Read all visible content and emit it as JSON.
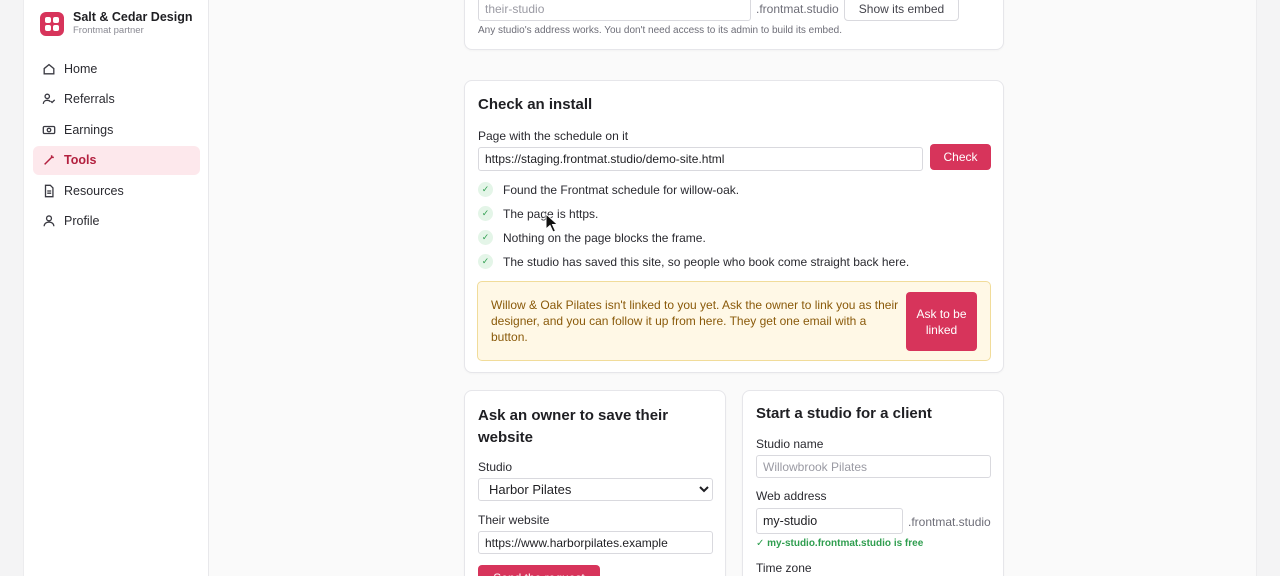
{
  "brand": {
    "name": "Salt & Cedar Design",
    "subtitle": "Frontmat partner",
    "icon": "grid-logo-icon",
    "color": "#d7345b"
  },
  "nav": {
    "items": [
      {
        "label": "Home",
        "icon": "home-icon",
        "active": false
      },
      {
        "label": "Referrals",
        "icon": "user-check-icon",
        "active": false
      },
      {
        "label": "Earnings",
        "icon": "cash-icon",
        "active": false
      },
      {
        "label": "Tools",
        "icon": "wand-icon",
        "active": true
      },
      {
        "label": "Resources",
        "icon": "document-icon",
        "active": false
      },
      {
        "label": "Profile",
        "icon": "user-icon",
        "active": false
      }
    ]
  },
  "embed_card": {
    "studio_placeholder": "their-studio",
    "domain_suffix": ".frontmat.studio",
    "show_button": "Show its embed",
    "hint": "Any studio's address works. You don't need access to its admin to build its embed."
  },
  "install_card": {
    "title": "Check an install",
    "page_label": "Page with the schedule on it",
    "page_value": "https://staging.frontmat.studio/demo-site.html",
    "check_button": "Check",
    "checks": [
      "Found the Frontmat schedule for willow-oak.",
      "The page is https.",
      "Nothing on the page blocks the frame.",
      "The studio has saved this site, so people who book come straight back here."
    ],
    "check_icon": "✓",
    "notice_text": "Willow & Oak Pilates isn't linked to you yet. Ask the owner to link you as their designer, and you can follow it up from here. They get one email with a button.",
    "notice_button": "Ask to be linked"
  },
  "save_card": {
    "title": "Ask an owner to save their website",
    "studio_label": "Studio",
    "studio_selected": "Harbor Pilates",
    "website_label": "Their website",
    "website_value": "https://www.harborpilates.example",
    "send_button": "Send the request"
  },
  "client_card": {
    "title": "Start a studio for a client",
    "name_label": "Studio name",
    "name_placeholder": "Willowbrook Pilates",
    "address_label": "Web address",
    "address_value": "my-studio",
    "domain_suffix": ".frontmat.studio",
    "availability": "✓ my-studio.frontmat.studio is free",
    "timezone_label": "Time zone"
  }
}
